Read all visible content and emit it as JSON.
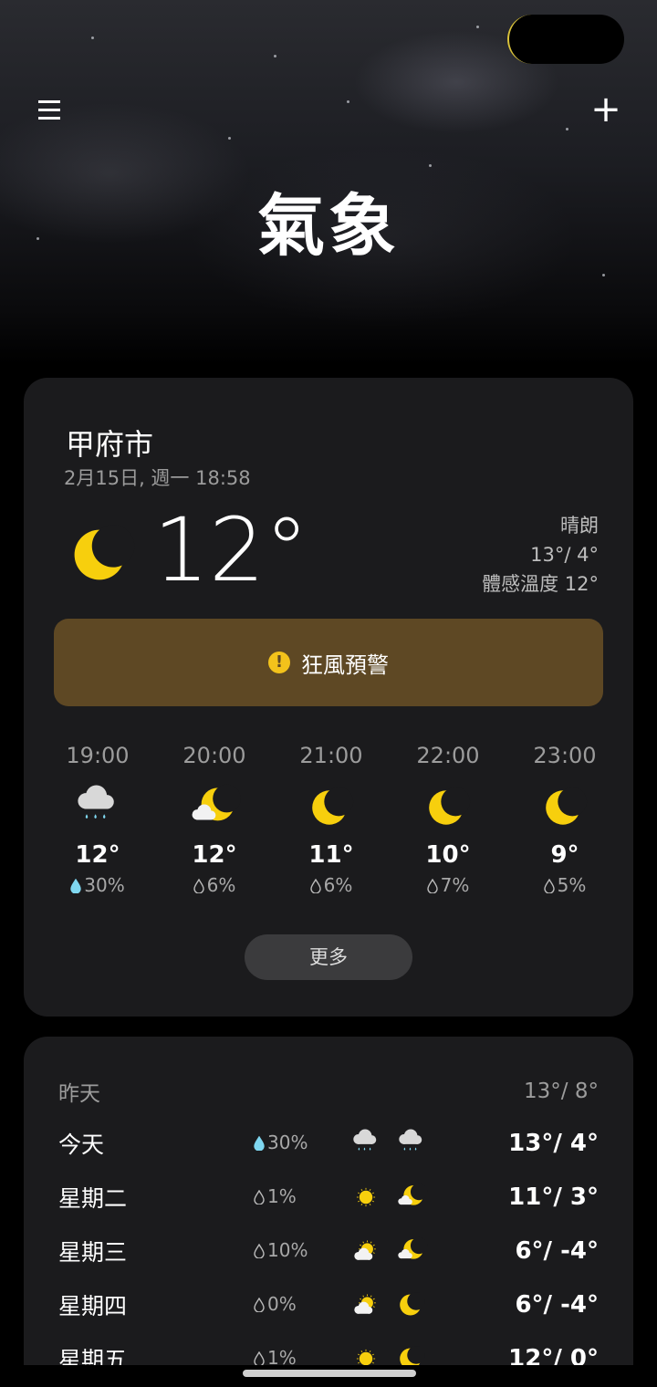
{
  "header": {
    "title": "氣象",
    "menu_icon": "menu-icon",
    "add_icon": "+"
  },
  "current": {
    "city": "甲府市",
    "datetime": "2月15日, 週一 18:58",
    "icon": "moon-icon",
    "temperature": "12°",
    "condition": "晴朗",
    "high_low": "13°/ 4°",
    "feels_like": "體感溫度 12°"
  },
  "alert": {
    "icon": "!",
    "text": "狂風預警",
    "color": "#5e4824"
  },
  "hourly": [
    {
      "time": "19:00",
      "icon": "cloud-rain-icon",
      "temp": "12°",
      "pop": "30%"
    },
    {
      "time": "20:00",
      "icon": "moon-cloud-icon",
      "temp": "12°",
      "pop": "6%"
    },
    {
      "time": "21:00",
      "icon": "moon-icon",
      "temp": "11°",
      "pop": "6%"
    },
    {
      "time": "22:00",
      "icon": "moon-icon",
      "temp": "10°",
      "pop": "7%"
    },
    {
      "time": "23:00",
      "icon": "moon-icon",
      "temp": "9°",
      "pop": "5%"
    }
  ],
  "more_label": "更多",
  "daily": [
    {
      "day": "昨天",
      "pop": "",
      "icon_day": "",
      "icon_night": "",
      "temp": "13°/ 8°"
    },
    {
      "day": "今天",
      "pop": "30%",
      "icon_day": "cloud-rain-icon",
      "icon_night": "cloud-rain-icon",
      "temp": "13°/ 4°"
    },
    {
      "day": "星期二",
      "pop": "1%",
      "icon_day": "sun-icon",
      "icon_night": "moon-cloud-icon",
      "temp": "11°/ 3°"
    },
    {
      "day": "星期三",
      "pop": "10%",
      "icon_day": "sun-cloud-icon",
      "icon_night": "moon-cloud-icon",
      "temp": "6°/ -4°"
    },
    {
      "day": "星期四",
      "pop": "0%",
      "icon_day": "sun-cloud-icon",
      "icon_night": "moon-icon",
      "temp": "6°/ -4°"
    },
    {
      "day": "星期五",
      "pop": "1%",
      "icon_day": "sun-icon",
      "icon_night": "moon-icon",
      "temp": "12°/ 0°"
    }
  ],
  "colors": {
    "moon": "#f7cf0d",
    "sun": "#f7cf0d",
    "rain_drop": "#7fd7f0",
    "card": "#1b1b1d"
  }
}
